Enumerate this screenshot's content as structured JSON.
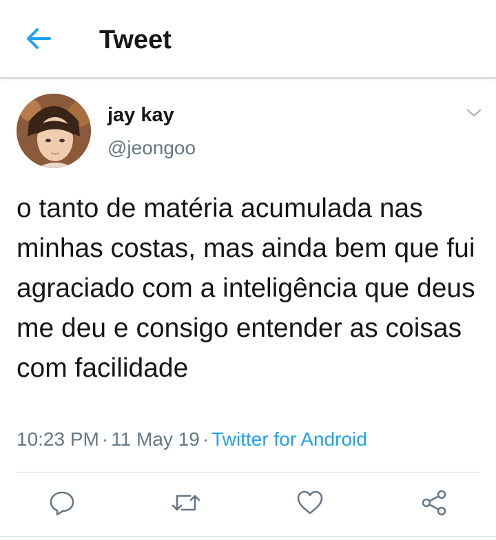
{
  "header": {
    "back_icon": "arrow-left-icon",
    "title": "Tweet"
  },
  "tweet": {
    "author": {
      "name": "jay kay",
      "handle": "@jeongoo",
      "avatar": "profile-photo"
    },
    "menu_icon": "chevron-down-icon",
    "text": "o tanto de matéria acumulada nas minhas costas, mas ainda bem que fui agraciado com a inteligência que deus me deu e consigo entender as coisas com facilidade",
    "time": "10:23 PM",
    "separator": "·",
    "date": "11 May 19",
    "source": "Twitter for Android"
  },
  "actions": [
    {
      "icon": "reply-icon"
    },
    {
      "icon": "retweet-icon"
    },
    {
      "icon": "like-icon"
    },
    {
      "icon": "share-icon"
    }
  ],
  "colors": {
    "accent": "#1da1f2",
    "text": "#14171a",
    "secondary": "#657786",
    "divider": "#d6d9dc"
  }
}
